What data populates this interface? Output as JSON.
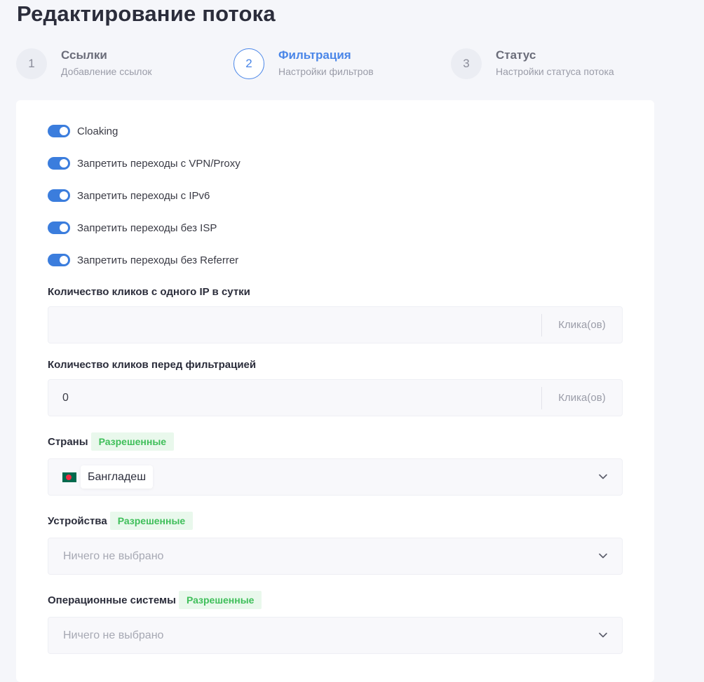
{
  "page": {
    "title": "Редактирование потока"
  },
  "stepper": {
    "steps": [
      {
        "number": "1",
        "title": "Ссылки",
        "subtitle": "Добавление ссылок"
      },
      {
        "number": "2",
        "title": "Фильтрация",
        "subtitle": "Настройки фильтров"
      },
      {
        "number": "3",
        "title": "Статус",
        "subtitle": "Настройки статуса потока"
      }
    ]
  },
  "filters": {
    "toggles": [
      {
        "label": "Cloaking",
        "enabled": true
      },
      {
        "label": "Запретить переходы с VPN/Proxy",
        "enabled": true
      },
      {
        "label": "Запретить переходы с IPv6",
        "enabled": true
      },
      {
        "label": "Запретить переходы без ISP",
        "enabled": true
      },
      {
        "label": "Запретить переходы без Referrer",
        "enabled": true
      }
    ],
    "clicks_per_ip": {
      "label": "Количество кликов с одного IP в сутки",
      "value": "",
      "suffix": "Клика(ов)"
    },
    "clicks_before_filter": {
      "label": "Количество кликов перед фильтрацией",
      "value": "0",
      "suffix": "Клика(ов)"
    },
    "countries": {
      "label": "Страны",
      "badge": "Разрешенные",
      "selected": "Бангладеш"
    },
    "devices": {
      "label": "Устройства",
      "badge": "Разрешенные",
      "placeholder": "Ничего не выбрано"
    },
    "os": {
      "label": "Операционные системы",
      "badge": "Разрешенные",
      "placeholder": "Ничего не выбрано"
    }
  },
  "colors": {
    "accent": "#4a86e8",
    "toggle_on": "#3b7ddd",
    "badge_text": "#3fbf5a",
    "badge_bg": "#e9f8ec"
  },
  "icons": {
    "country_flag": "bangladesh-flag-icon",
    "dropdown": "chevron-down-icon"
  }
}
